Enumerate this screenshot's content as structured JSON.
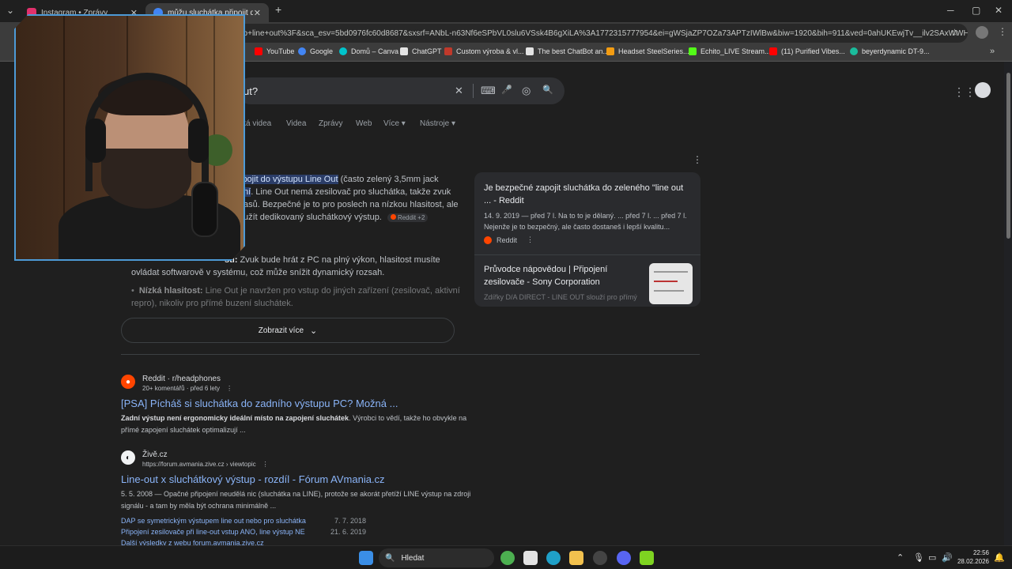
{
  "tabs": [
    {
      "title": "Instagram • Zprávy",
      "color": "#e1306c"
    },
    {
      "title": "můžu sluchátka připojit do line",
      "color": "#4285f4"
    }
  ],
  "window": {
    "minimize": "─",
    "maximize": "▢",
    "close": "✕",
    "new_tab": "+",
    "tab_menu": "⌄"
  },
  "address": {
    "url": "do+line+out%3F&sca_esv=5bd0976fc60d8687&sxsrf=ANbL-n63Nf6eSPbVL0slu6VSsk4B6gXiLA%3A1772315777954&ei=gWSjaZP7OZa73APTzIWlBw&biw=1920&bih=911&ved=0ahUKEwjTv__ilv2SAxWWHXcKHVN..."
  },
  "bookmarks": [
    {
      "label": "YouTube",
      "color": "#ff0000"
    },
    {
      "label": "Google",
      "color": "#4285f4"
    },
    {
      "label": "Domů – Canva",
      "color": "#00c4cc"
    },
    {
      "label": "ChatGPT",
      "color": "#e3e3e3"
    },
    {
      "label": "Custom výroba & vl...",
      "color": "#c0392b"
    },
    {
      "label": "The best ChatBot an...",
      "color": "#e3e3e3"
    },
    {
      "label": "Headset SteelSeries...",
      "color": "#f39c12"
    },
    {
      "label": "Echito_LIVE Stream...",
      "color": "#53fc18"
    },
    {
      "label": "(11) Purified Vibes...",
      "color": "#ff0000"
    },
    {
      "label": "beyerdynamic DT-9...",
      "color": "#1abc9c"
    }
  ],
  "search": {
    "query": "ut?",
    "clear": "✕",
    "keyboard": "⌨",
    "mic": "🎤",
    "lens": "◎",
    "search": "🔍"
  },
  "filters": [
    {
      "label": "ká videa"
    },
    {
      "label": "Videa"
    },
    {
      "label": "Zprávy"
    },
    {
      "label": "Web"
    },
    {
      "label": "Více ▾"
    },
    {
      "label": "Nástroje ▾"
    }
  ],
  "ai": {
    "line1_hl": "ipojit do výstupu Line Out",
    "line1_rest": " (často zelený 3,5mm jack",
    "line2_hl": "ní",
    "line2_rest": ". Line Out nemá zesilovač pro sluchátka, takže zvuk",
    "line3": "asů. Bezpečné je to pro poslech na nízkou hlasitost, ale",
    "line4": "užít dedikovaný sluchátkový výstup.",
    "line4_badge": "Reddit +2",
    "bullet1_bold": "sti:",
    "bullet1_text": " Zvuk bude hrát z PC na plný výkon, hlasitost musíte",
    "bullet1_text2": "ovládat softwarově v systému, což může snížit dynamický rozsah.",
    "bullet2_bold": "Nízká hlasitost:",
    "bullet2_text": " Line Out je navržen pro vstup do jiných zařízení (zesilovač, aktivní",
    "bullet2_text2": "repro), nikoliv pro přímé buzení sluchátek.",
    "more": "Zobrazit více",
    "more_chevron": "⌄"
  },
  "panel": {
    "card1": {
      "title": "Je bezpečné zapojit sluchátka do zeleného \"line out ... - Reddit",
      "meta": "14. 9. 2019 — před 7 l. Na to to je dělaný. ... před 7 l. ... před 7 l. Nejenže je to bezpečný, ale často dostaneš i lepší kvalitu...",
      "source": "Reddit"
    },
    "card2": {
      "title": "Průvodce nápovědou | Připojení zesilovače - Sony Corporation",
      "meta": "Zdířky D/A DIRECT - LINE OUT slouží pro přímý"
    }
  },
  "results": [
    {
      "site": "Reddit · r/headphones",
      "url": "20+ komentářů · před 6 lety",
      "title": "[PSA] Pícháš si sluchátka do zadního výstupu PC? Možná ...",
      "snippet_bold": "Zadní výstup není ergonomicky ideální místo na zapojení sluchátek",
      "snippet": ". Výrobci to vědí, takže ho obvykle na přímé zapojení sluchátek optimalizují ...",
      "logo_color": "#ff4500"
    },
    {
      "site": "Živě.cz",
      "url": "https://forum.avmania.zive.cz › viewtopic",
      "title": "Line-out x sluchátkový výstup - rozdíl - Fórum AVmania.cz",
      "snippet": "5. 5. 2008 — Opačné připojení neudělá nic (sluchátka na LINE), protože se akorát přetíží LINE výstup na zdroji signálu - a tam by měla být ochrana minimálně ...",
      "logo_color": "#f1f3f4"
    }
  ],
  "sublinks": [
    {
      "text": "DAP se symetrickým výstupem line out nebo pro sluchátka",
      "date": "7. 7. 2018"
    },
    {
      "text": "Připojení zesilovače při line-out vstup ANO, line výstup NE",
      "date": "21. 6. 2019"
    },
    {
      "text": "Další výsledky z webu forum.avmania.zive.cz",
      "date": ""
    }
  ],
  "taskbar": {
    "search": "Hledat",
    "time": "22:56",
    "date": "28.02.2026",
    "icons": [
      {
        "name": "windows-start-icon",
        "color": "#3a8ee6"
      },
      {
        "name": "chrome-icon",
        "color": "#4caf50"
      },
      {
        "name": "store-icon",
        "color": "#e3e3e3"
      },
      {
        "name": "edge-icon",
        "color": "#1fa0c8"
      },
      {
        "name": "explorer-icon",
        "color": "#f2c14e"
      },
      {
        "name": "obs-icon",
        "color": "#444444"
      },
      {
        "name": "discord-icon",
        "color": "#5865f2"
      },
      {
        "name": "bf-icon",
        "color": "#7ed321"
      }
    ]
  }
}
